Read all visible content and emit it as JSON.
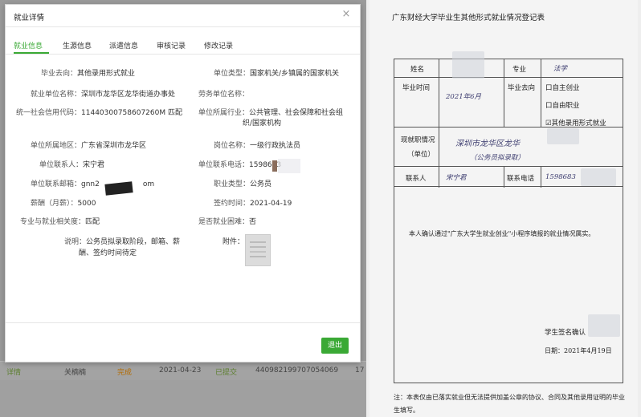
{
  "modal": {
    "title": "就业详情",
    "close": "×",
    "tabs": [
      "就业信息",
      "生源信息",
      "派遣信息",
      "审核记录",
      "修改记录"
    ],
    "fields": {
      "grad_destination_label": "毕业去向：",
      "grad_destination": "其他录用形式就业",
      "unit_type_label": "单位类型：",
      "unit_type": "国家机关/乡镇属的国家机关",
      "employer_label": "就业单位名称：",
      "employer": "深圳市龙华区龙华街道办事处",
      "labor_unit_label": "劳务单位名称：",
      "credit_code_label": "统一社会信用代码：",
      "credit_code": "11440300758607260M 匹配",
      "industry_label": "单位所属行业：",
      "industry_line1": "公共管理、社会保障和社会组",
      "industry_line2": "织/国家机构",
      "region_label": "单位所属地区：",
      "region": "广东省深圳市龙华区",
      "position_label": "岗位名称：",
      "position": "一级行政执法员",
      "contact_label": "单位联系人：",
      "contact": "宋宁君",
      "phone_label": "单位联系电话：",
      "phone": "1598683",
      "email_label": "单位联系邮箱：",
      "email_prefix": "gnn2",
      "email_suffix": "om",
      "job_type_label": "职业类型：",
      "job_type": "公务员",
      "salary_label": "薪酬（月薪）：",
      "salary": "5000",
      "sign_date_label": "签约时间：",
      "sign_date": "2021-04-19",
      "match_label": "专业与就业相关度：",
      "match": "匹配",
      "difficulty_label": "是否就业困难：",
      "difficulty": "否",
      "note_label": "说明：",
      "note_line1": "公务员拟录取阶段，邮箱、薪",
      "note_line2": "酬、签约时间待定",
      "attachment_label": "附件："
    },
    "exit_button": "退出"
  },
  "background_row": {
    "status": "详情",
    "name": "关楠楠",
    "result": "完成",
    "date": "2021-04-23",
    "state": "已提交",
    "id_number": "440982199707054069",
    "trailing": "17"
  },
  "document": {
    "title": "广东财经大学毕业生其他形式就业情况登记表",
    "name_label": "姓名",
    "major_label": "专业",
    "major_value": "法学",
    "grad_time_label": "毕业时间",
    "grad_time_value": "2021年6月",
    "destination_label": "毕业去向",
    "opt1": "口自主创业",
    "opt2": "口自由职业",
    "opt3": "☑其他录用形式就业",
    "work_label_1": "现就职情况",
    "work_label_2": "（单位）",
    "work_value_1": "深圳市龙华区龙华",
    "work_value_2": "（公务员拟录取）",
    "contact_label": "联系人",
    "contact_value": "宋宁君",
    "phone_label": "联系电话",
    "phone_value": "1598683",
    "statement": "本人确认通过\"广东大学生就业创业\"小程序填报的就业情况属实。",
    "sign": "学生签名确认",
    "date": "日期：2021年4月19日",
    "note": "注：本表仅由已落实就业但无法提供加盖公章的协议、合同及其他录用证明的毕业生填写。"
  }
}
